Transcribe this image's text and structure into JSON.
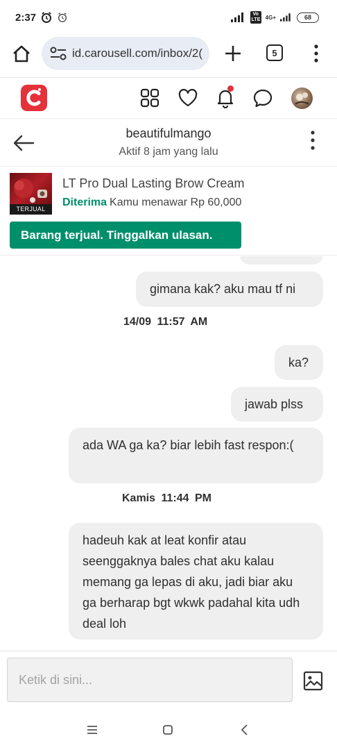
{
  "status_bar": {
    "time": "2:37",
    "network_label": "4G+",
    "volte_label": "Vo LTE",
    "battery": "68"
  },
  "browser": {
    "url": "id.carousell.com/inbox/2(",
    "tab_count": "5"
  },
  "app_header": {
    "icons": [
      "carousell-logo",
      "grid-icon",
      "heart-icon",
      "bell-icon",
      "chat-icon",
      "avatar"
    ],
    "brand_color": "#e4313a"
  },
  "chat": {
    "name": "beautifulmango",
    "last_seen": "Aktif 8 jam yang lalu"
  },
  "listing": {
    "title": "LT Pro Dual Lasting Brow Cream",
    "badge": "TERJUAL",
    "status_label": "Diterima",
    "offer_text": "Kamu menawar Rp 60,000",
    "action_label": "Barang terjual. Tinggalkan ulasan.",
    "accent_color": "#008f6b"
  },
  "messages": [
    {
      "type": "bubble",
      "side": "right",
      "text": "gimana kak? aku mau tf ni"
    },
    {
      "type": "timestamp",
      "text": "14/09  11:57 AM"
    },
    {
      "type": "bubble",
      "side": "right",
      "text": "ka?"
    },
    {
      "type": "bubble",
      "side": "right",
      "text": "jawab plss"
    },
    {
      "type": "bubble",
      "side": "right",
      "text": "ada WA ga ka? biar lebih fast respon:("
    },
    {
      "type": "timestamp",
      "text": "Kamis  11:44 PM"
    },
    {
      "type": "bubble",
      "side": "right",
      "text": "hadeuh kak at leat konfir atau seenggaknya bales chat aku kalau memang ga lepas di aku, jadi biar aku ga berharap bgt wkwk padahal kita udh deal loh"
    }
  ],
  "composer": {
    "placeholder": "Ketik di sini..."
  }
}
